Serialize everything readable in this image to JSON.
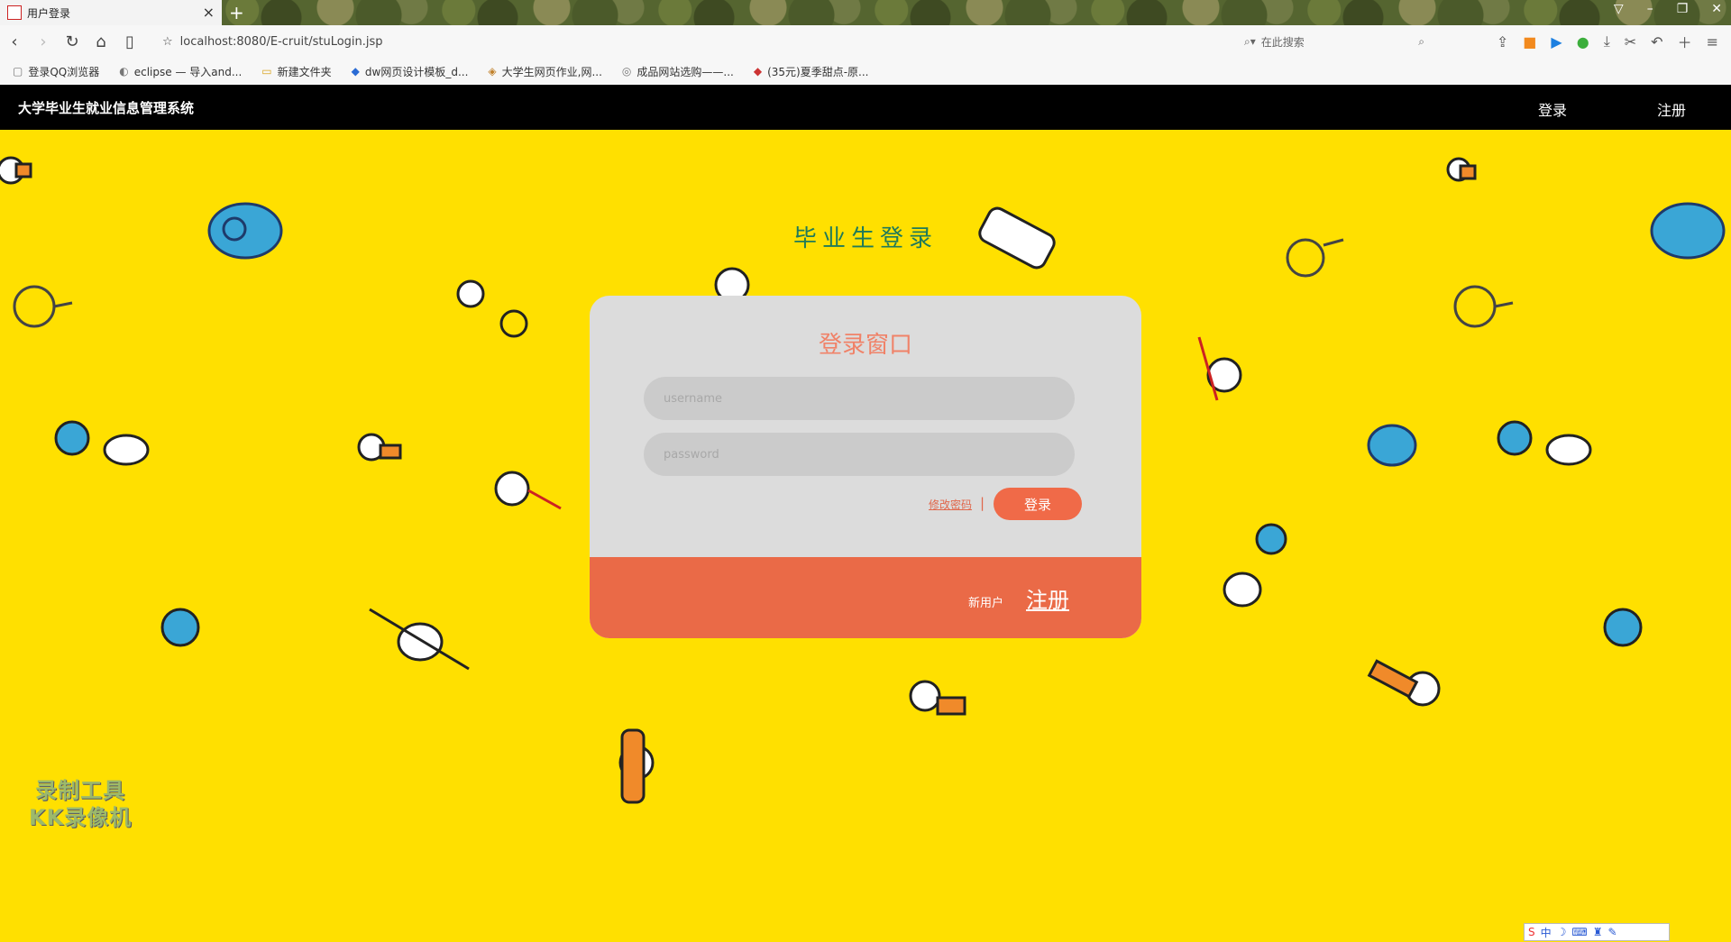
{
  "browser": {
    "tab_title": "用户登录",
    "tab_close": "×",
    "new_tab": "+",
    "url": "localhost:8080/E-cruit/stuLogin.jsp",
    "search_placeholder": "在此搜索"
  },
  "bookmarks": [
    {
      "label": "登录QQ浏览器",
      "icon": "page-icon"
    },
    {
      "label": "eclipse — 导入and...",
      "icon": "eclipse-icon"
    },
    {
      "label": "新建文件夹",
      "icon": "folder-icon"
    },
    {
      "label": "dw网页设计模板_d...",
      "icon": "link-icon"
    },
    {
      "label": "大学生网页作业,网...",
      "icon": "box-icon"
    },
    {
      "label": "成品网站选购——...",
      "icon": "globe-icon"
    },
    {
      "label": "(35元)夏季甜点-原...",
      "icon": "link-icon"
    }
  ],
  "header": {
    "brand": "大学毕业生就业信息管理系统",
    "login": "登录",
    "register": "注册"
  },
  "page": {
    "title": "毕业生登录"
  },
  "login_card": {
    "title": "登录窗口",
    "username_placeholder": "username",
    "password_placeholder": "password",
    "forgot": "修改密码",
    "separator": "|",
    "login_button": "登录",
    "new_user": "新用户",
    "register": "注册"
  },
  "watermark": {
    "line1": "录制工具",
    "line2": "KK录像机"
  },
  "ime_bar": {
    "label": "中"
  },
  "colors": {
    "page_bg": "#ffe000",
    "header_bg": "#000000",
    "card_bg": "#dcdcdc",
    "accent": "#ea6a47",
    "title_green": "#1f7a5a"
  }
}
